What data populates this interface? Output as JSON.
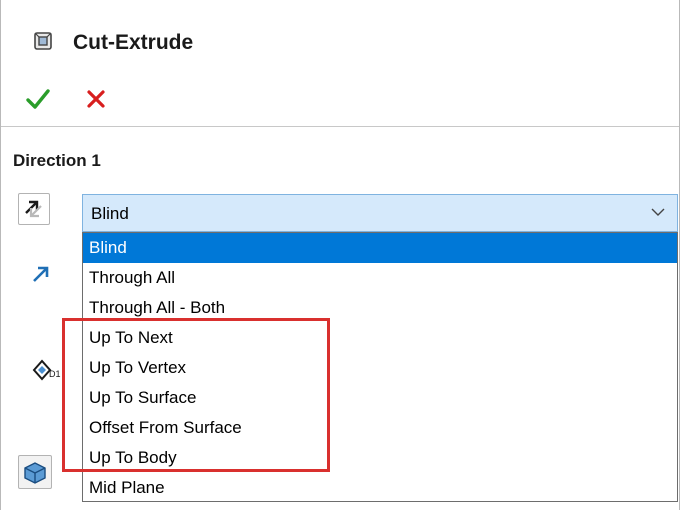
{
  "header": {
    "title": "Cut-Extrude"
  },
  "actions": {
    "ok": "ok",
    "cancel": "cancel"
  },
  "direction": {
    "section_title": "Direction 1",
    "end_condition": "Blind",
    "options": [
      "Blind",
      "Through All",
      "Through All - Both",
      "Up To Next",
      "Up To Vertex",
      "Up To Surface",
      "Offset From Surface",
      "Up To Body",
      "Mid Plane"
    ],
    "selected_index": 0
  },
  "colors": {
    "ok": "#2a9d2a",
    "cancel": "#d81e1e",
    "selection": "#0078d7",
    "highlight": "#d9302e"
  },
  "icons": {
    "header": "cut-extrude-icon",
    "reverse": "reverse-direction-icon",
    "direction": "direction-arrow-icon",
    "depth": "depth-dimension-icon",
    "body": "solid-body-icon"
  }
}
